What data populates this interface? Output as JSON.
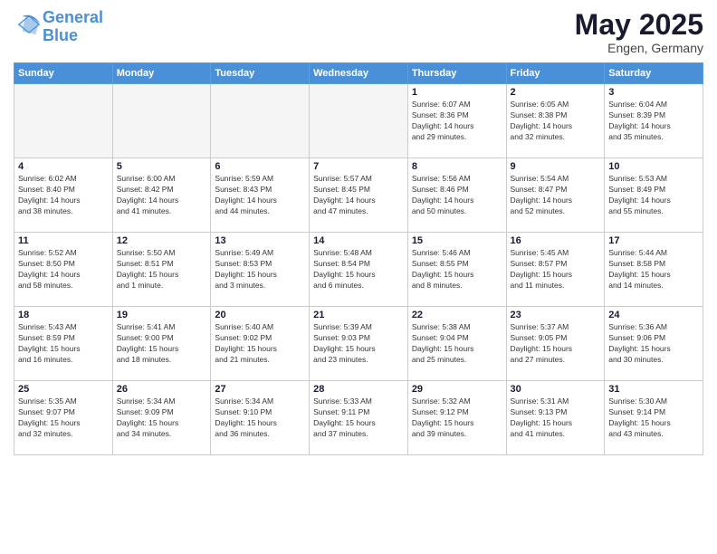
{
  "logo": {
    "line1": "General",
    "line2": "Blue"
  },
  "title": "May 2025",
  "location": "Engen, Germany",
  "days_of_week": [
    "Sunday",
    "Monday",
    "Tuesday",
    "Wednesday",
    "Thursday",
    "Friday",
    "Saturday"
  ],
  "weeks": [
    [
      {
        "day": "",
        "info": ""
      },
      {
        "day": "",
        "info": ""
      },
      {
        "day": "",
        "info": ""
      },
      {
        "day": "",
        "info": ""
      },
      {
        "day": "1",
        "info": "Sunrise: 6:07 AM\nSunset: 8:36 PM\nDaylight: 14 hours\nand 29 minutes."
      },
      {
        "day": "2",
        "info": "Sunrise: 6:05 AM\nSunset: 8:38 PM\nDaylight: 14 hours\nand 32 minutes."
      },
      {
        "day": "3",
        "info": "Sunrise: 6:04 AM\nSunset: 8:39 PM\nDaylight: 14 hours\nand 35 minutes."
      }
    ],
    [
      {
        "day": "4",
        "info": "Sunrise: 6:02 AM\nSunset: 8:40 PM\nDaylight: 14 hours\nand 38 minutes."
      },
      {
        "day": "5",
        "info": "Sunrise: 6:00 AM\nSunset: 8:42 PM\nDaylight: 14 hours\nand 41 minutes."
      },
      {
        "day": "6",
        "info": "Sunrise: 5:59 AM\nSunset: 8:43 PM\nDaylight: 14 hours\nand 44 minutes."
      },
      {
        "day": "7",
        "info": "Sunrise: 5:57 AM\nSunset: 8:45 PM\nDaylight: 14 hours\nand 47 minutes."
      },
      {
        "day": "8",
        "info": "Sunrise: 5:56 AM\nSunset: 8:46 PM\nDaylight: 14 hours\nand 50 minutes."
      },
      {
        "day": "9",
        "info": "Sunrise: 5:54 AM\nSunset: 8:47 PM\nDaylight: 14 hours\nand 52 minutes."
      },
      {
        "day": "10",
        "info": "Sunrise: 5:53 AM\nSunset: 8:49 PM\nDaylight: 14 hours\nand 55 minutes."
      }
    ],
    [
      {
        "day": "11",
        "info": "Sunrise: 5:52 AM\nSunset: 8:50 PM\nDaylight: 14 hours\nand 58 minutes."
      },
      {
        "day": "12",
        "info": "Sunrise: 5:50 AM\nSunset: 8:51 PM\nDaylight: 15 hours\nand 1 minute."
      },
      {
        "day": "13",
        "info": "Sunrise: 5:49 AM\nSunset: 8:53 PM\nDaylight: 15 hours\nand 3 minutes."
      },
      {
        "day": "14",
        "info": "Sunrise: 5:48 AM\nSunset: 8:54 PM\nDaylight: 15 hours\nand 6 minutes."
      },
      {
        "day": "15",
        "info": "Sunrise: 5:46 AM\nSunset: 8:55 PM\nDaylight: 15 hours\nand 8 minutes."
      },
      {
        "day": "16",
        "info": "Sunrise: 5:45 AM\nSunset: 8:57 PM\nDaylight: 15 hours\nand 11 minutes."
      },
      {
        "day": "17",
        "info": "Sunrise: 5:44 AM\nSunset: 8:58 PM\nDaylight: 15 hours\nand 14 minutes."
      }
    ],
    [
      {
        "day": "18",
        "info": "Sunrise: 5:43 AM\nSunset: 8:59 PM\nDaylight: 15 hours\nand 16 minutes."
      },
      {
        "day": "19",
        "info": "Sunrise: 5:41 AM\nSunset: 9:00 PM\nDaylight: 15 hours\nand 18 minutes."
      },
      {
        "day": "20",
        "info": "Sunrise: 5:40 AM\nSunset: 9:02 PM\nDaylight: 15 hours\nand 21 minutes."
      },
      {
        "day": "21",
        "info": "Sunrise: 5:39 AM\nSunset: 9:03 PM\nDaylight: 15 hours\nand 23 minutes."
      },
      {
        "day": "22",
        "info": "Sunrise: 5:38 AM\nSunset: 9:04 PM\nDaylight: 15 hours\nand 25 minutes."
      },
      {
        "day": "23",
        "info": "Sunrise: 5:37 AM\nSunset: 9:05 PM\nDaylight: 15 hours\nand 27 minutes."
      },
      {
        "day": "24",
        "info": "Sunrise: 5:36 AM\nSunset: 9:06 PM\nDaylight: 15 hours\nand 30 minutes."
      }
    ],
    [
      {
        "day": "25",
        "info": "Sunrise: 5:35 AM\nSunset: 9:07 PM\nDaylight: 15 hours\nand 32 minutes."
      },
      {
        "day": "26",
        "info": "Sunrise: 5:34 AM\nSunset: 9:09 PM\nDaylight: 15 hours\nand 34 minutes."
      },
      {
        "day": "27",
        "info": "Sunrise: 5:34 AM\nSunset: 9:10 PM\nDaylight: 15 hours\nand 36 minutes."
      },
      {
        "day": "28",
        "info": "Sunrise: 5:33 AM\nSunset: 9:11 PM\nDaylight: 15 hours\nand 37 minutes."
      },
      {
        "day": "29",
        "info": "Sunrise: 5:32 AM\nSunset: 9:12 PM\nDaylight: 15 hours\nand 39 minutes."
      },
      {
        "day": "30",
        "info": "Sunrise: 5:31 AM\nSunset: 9:13 PM\nDaylight: 15 hours\nand 41 minutes."
      },
      {
        "day": "31",
        "info": "Sunrise: 5:30 AM\nSunset: 9:14 PM\nDaylight: 15 hours\nand 43 minutes."
      }
    ]
  ]
}
